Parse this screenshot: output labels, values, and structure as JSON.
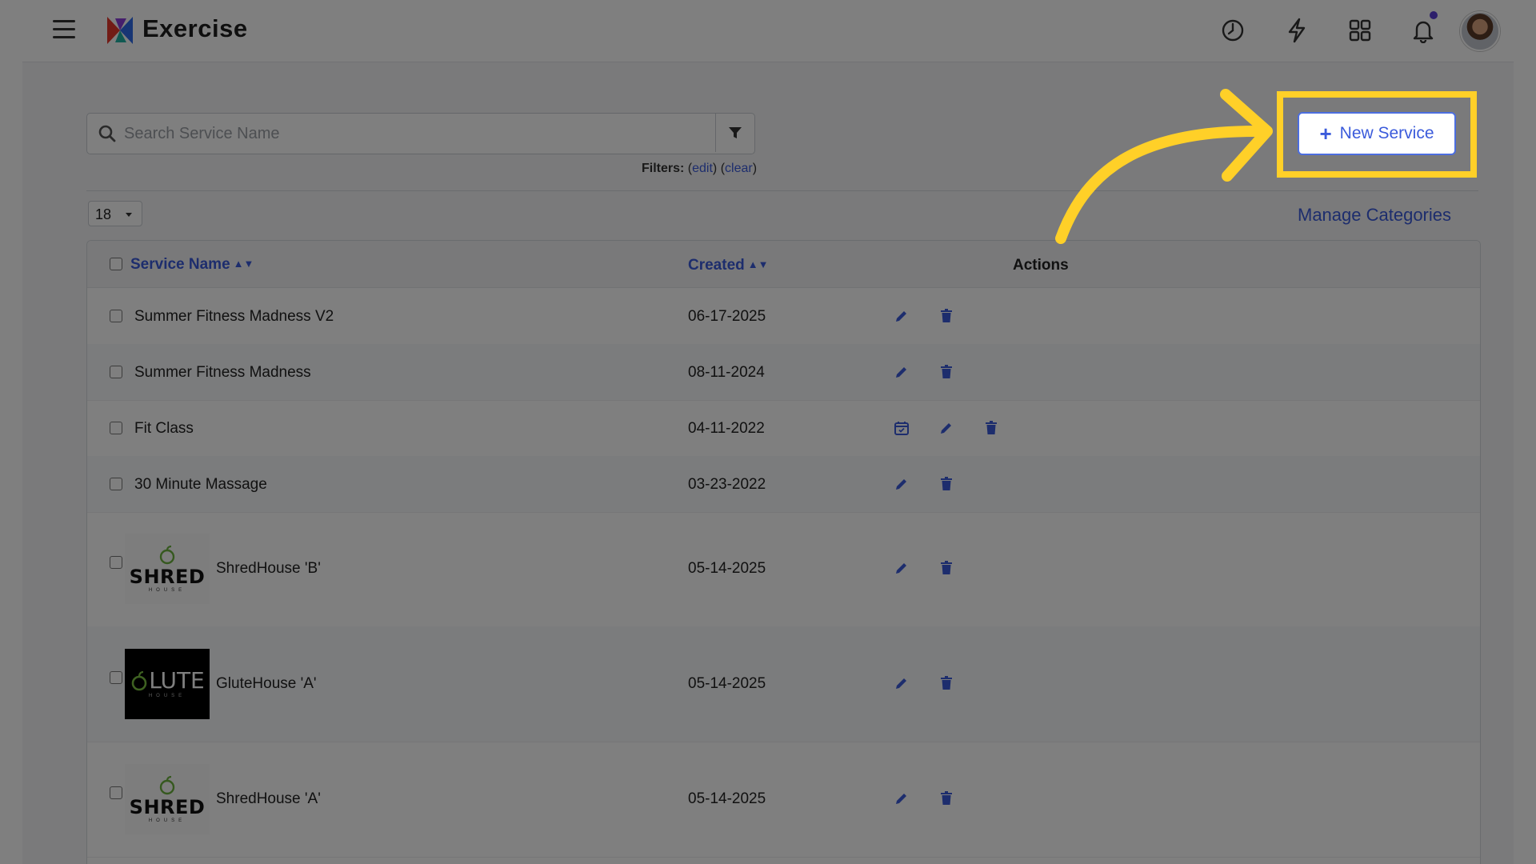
{
  "header": {
    "title": "Exercise",
    "icons": [
      "history-icon",
      "lightning-icon",
      "apps-grid-icon",
      "bell-icon"
    ],
    "has_notification": true
  },
  "search": {
    "placeholder": "Search Service Name",
    "value": ""
  },
  "filters": {
    "label": "Filters:",
    "edit": "edit",
    "clear": "clear"
  },
  "page_size": {
    "value": "18"
  },
  "manage_categories_label": "Manage Categories",
  "new_service_label": "New Service",
  "table": {
    "headers": {
      "name": "Service Name",
      "created": "Created",
      "actions": "Actions"
    },
    "rows": [
      {
        "name": "Summer Fitness Madness V2",
        "created": "06-17-2025",
        "actions": [
          "edit",
          "delete"
        ]
      },
      {
        "name": "Summer Fitness Madness",
        "created": "08-11-2024",
        "actions": [
          "edit",
          "delete"
        ]
      },
      {
        "name": "Fit Class",
        "created": "04-11-2022",
        "actions": [
          "calendar",
          "edit",
          "delete"
        ]
      },
      {
        "name": "30 Minute Massage",
        "created": "03-23-2022",
        "actions": [
          "edit",
          "delete"
        ]
      },
      {
        "name": "ShredHouse 'B'",
        "created": "05-14-2025",
        "actions": [
          "edit",
          "delete"
        ],
        "thumb": {
          "logo_text": "SHRED",
          "sub_text": "HOUSE"
        }
      },
      {
        "name": "GluteHouse 'A'",
        "created": "05-14-2025",
        "actions": [
          "edit",
          "delete"
        ],
        "thumb": {
          "logo_text": "LUTE",
          "sub_text": "HOUSE"
        }
      },
      {
        "name": "ShredHouse 'A'",
        "created": "05-14-2025",
        "actions": [
          "edit",
          "delete"
        ],
        "thumb": {
          "logo_text": "SHRED",
          "sub_text": "HOUSE"
        }
      }
    ]
  },
  "colors": {
    "accent": "#3b5bdb",
    "highlight": "#ffd028",
    "notification": "#5b3fd6"
  }
}
